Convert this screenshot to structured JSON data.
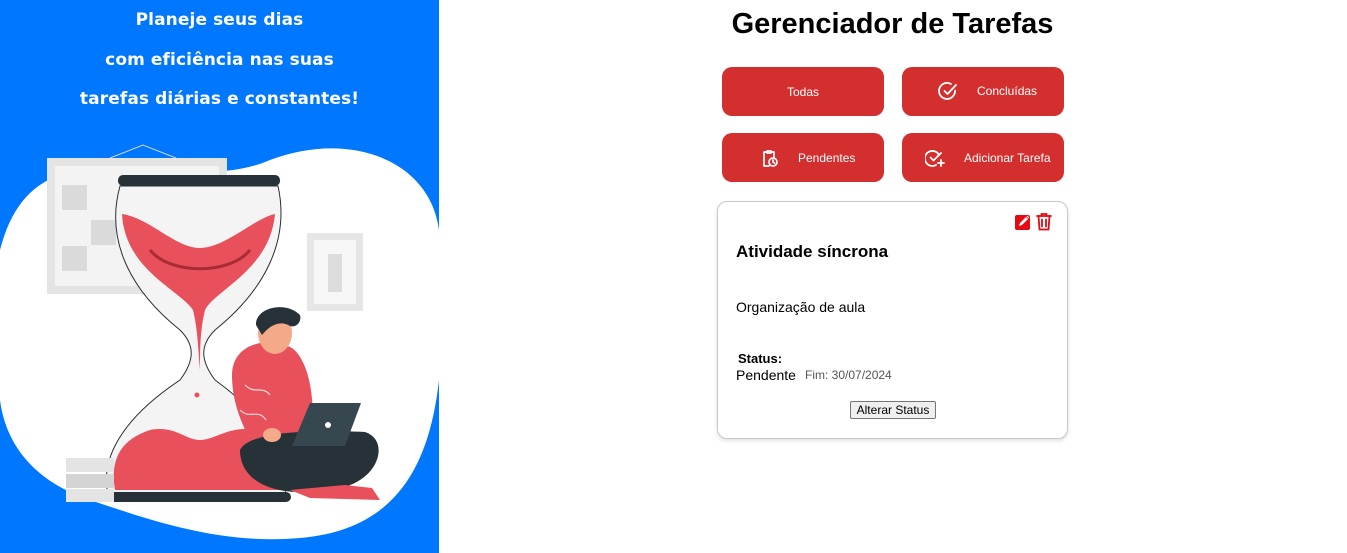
{
  "hero": {
    "lines": [
      "Planeje seus dias",
      "com eficiência nas suas",
      "tarefas diárias e constantes!"
    ],
    "background": "#0077ff",
    "illustration": "person-with-laptop-hourglass"
  },
  "header": {
    "title": "Gerenciador de Tarefas"
  },
  "filters": {
    "all_label": "Todas",
    "completed_label": "Concluídas",
    "completed_icon": "check-circle-icon",
    "pending_label": "Pendentes",
    "pending_icon": "clipboard-clock-icon",
    "add_label": "Adicionar Tarefa",
    "add_icon": "check-add-icon",
    "button_color": "#d32f2f"
  },
  "task": {
    "title": "Atividade síncrona",
    "description": "Organização de aula",
    "status_label": "Status:",
    "status_value": "Pendente",
    "due_date": "Fim: 30/07/2024",
    "alter_status_label": "Alterar Status",
    "edit_icon": "edit-icon",
    "delete_icon": "trash-icon"
  }
}
